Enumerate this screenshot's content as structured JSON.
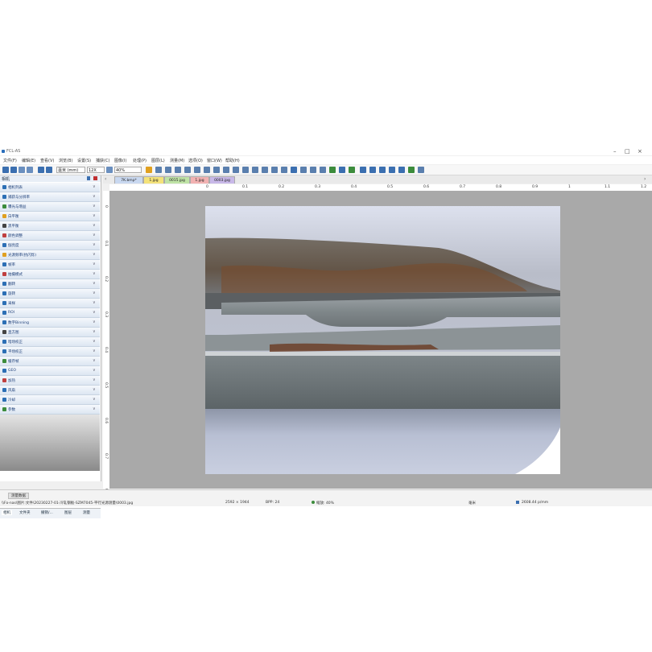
{
  "app": {
    "title": "FCL-AS"
  },
  "window_controls": {
    "minimize": "–",
    "maximize": "□",
    "close": "×"
  },
  "menu": [
    "文件(F)",
    "编辑(E)",
    "查看(V)",
    "浏览(B)",
    "设置(S)",
    "捕获(C)",
    "图像(I)",
    "处理(P)",
    "图层(L)",
    "测量(M)",
    "选项(O)",
    "窗口(W)",
    "帮助(H)"
  ],
  "toolbar": {
    "unit": "毫米 (mm)",
    "objective": "12X",
    "zoom": "40%"
  },
  "panel": {
    "title": "相机",
    "items": [
      {
        "label": "相机列表",
        "color": "#2c6fb5"
      },
      {
        "label": "捕获与分辨率",
        "color": "#2c6fb5"
      },
      {
        "label": "曝光与增益",
        "color": "#3c8c3c"
      },
      {
        "label": "白平衡",
        "color": "#e0a020"
      },
      {
        "label": "黑平衡",
        "color": "#444444"
      },
      {
        "label": "颜色调整",
        "color": "#c04040"
      },
      {
        "label": "伽亮度",
        "color": "#2c6fb5"
      },
      {
        "label": "光源频率(抗闪烁)",
        "color": "#e0a020"
      },
      {
        "label": "帧率",
        "color": "#2c6fb5"
      },
      {
        "label": "拍摄模式",
        "color": "#c04040"
      },
      {
        "label": "翻转",
        "color": "#2c6fb5"
      },
      {
        "label": "旋转",
        "color": "#2c6fb5"
      },
      {
        "label": "采样",
        "color": "#2c6fb5"
      },
      {
        "label": "ROI",
        "color": "#2c6fb5"
      },
      {
        "label": "数字Binning",
        "color": "#2c6fb5"
      },
      {
        "label": "直方图",
        "color": "#444444"
      },
      {
        "label": "暗场校正",
        "color": "#2c6fb5"
      },
      {
        "label": "平场校正",
        "color": "#2c6fb5"
      },
      {
        "label": "缓存帧",
        "color": "#3c8c3c"
      },
      {
        "label": "GEO",
        "color": "#2c6fb5"
      },
      {
        "label": "加热",
        "color": "#c04040"
      },
      {
        "label": "风扇",
        "color": "#2c6fb5"
      },
      {
        "label": "冷却",
        "color": "#2c6fb5"
      },
      {
        "label": "参数",
        "color": "#3c8c3c"
      }
    ],
    "chevron": "∨",
    "bottom_tabs": [
      "相机",
      "文件夹",
      "撤销/...",
      "图层",
      "测量"
    ]
  },
  "doc_tabs": [
    {
      "label": "7K.bmp*",
      "bg": "#c9d8f0"
    },
    {
      "label": "1.jpg",
      "bg": "#f4e27a"
    },
    {
      "label": "0015.jpg",
      "bg": "#bfe3a6"
    },
    {
      "label": "1.jpg",
      "bg": "#f2b2b2"
    },
    {
      "label": "0003.jpg",
      "bg": "#c8b8e8"
    }
  ],
  "ruler": {
    "h": [
      "0",
      "0.1",
      "0.2",
      "0.3",
      "0.4",
      "0.5",
      "0.6",
      "0.7",
      "0.8",
      "0.9",
      "1",
      "1.1",
      "1.2"
    ],
    "v": [
      "0",
      "0.1",
      "0.2",
      "0.3",
      "0.4",
      "0.5",
      "0.6",
      "0.7",
      "0.8"
    ]
  },
  "status": {
    "path": "\\\\Fo-nas\\图片:文件\\20230227-01-冷轧钢板-SZM7045-平行光源测量\\0003.jpg",
    "dimensions": "2592 × 1944",
    "bpp": "BPP: 24",
    "zoom": "缩放: 40%",
    "unit": "毫米",
    "resolution": "2608.44 p/mm",
    "panel_label": "测量数据"
  }
}
